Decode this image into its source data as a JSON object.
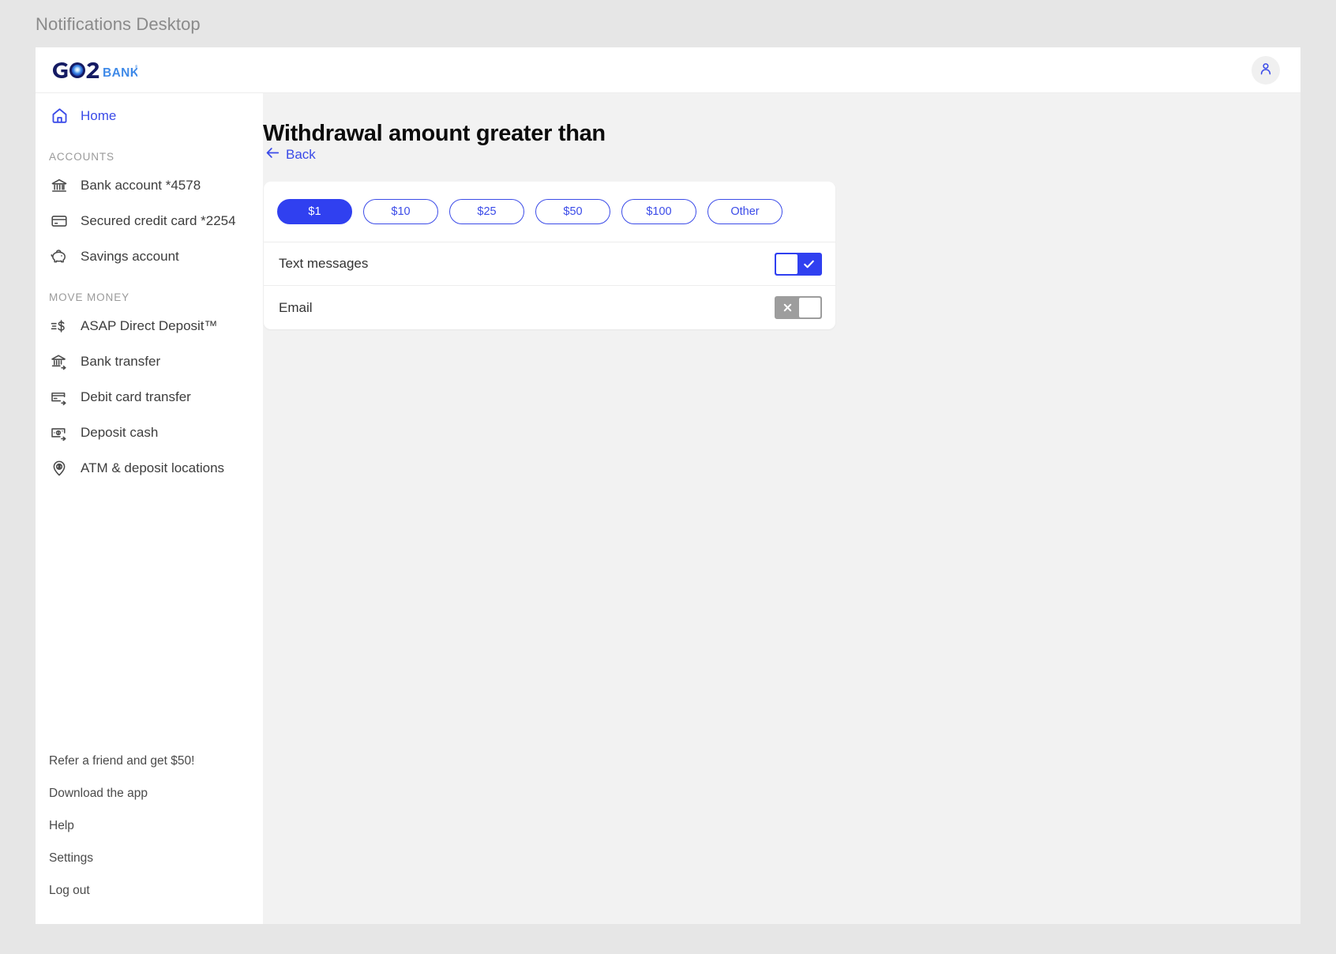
{
  "desktop": {
    "title": "Notifications Desktop"
  },
  "brand": {
    "logo_text_primary": "GO2",
    "logo_text_secondary": "BANK",
    "accent_blue": "#3040f0",
    "logo_navy": "#151b63",
    "logo_light_blue": "#3f8ae8"
  },
  "topbar": {
    "avatar_icon": "person-icon"
  },
  "sidebar": {
    "home": {
      "label": "Home",
      "icon": "home-icon",
      "active": true
    },
    "sections": [
      {
        "heading": "ACCOUNTS",
        "items": [
          {
            "label": "Bank account *4578",
            "icon": "bank-icon"
          },
          {
            "label": "Secured credit card *2254",
            "icon": "credit-card-icon"
          },
          {
            "label": "Savings account",
            "icon": "piggy-bank-icon"
          }
        ]
      },
      {
        "heading": "MOVE MONEY",
        "items": [
          {
            "label": "ASAP Direct Deposit™",
            "icon": "fast-dollar-icon"
          },
          {
            "label": "Bank transfer",
            "icon": "bank-arrow-icon"
          },
          {
            "label": "Debit card transfer",
            "icon": "card-arrow-icon"
          },
          {
            "label": "Deposit cash",
            "icon": "cash-arrow-icon"
          },
          {
            "label": "ATM & deposit locations",
            "icon": "map-pin-dollar-icon"
          }
        ]
      }
    ],
    "footer_links": [
      {
        "label": "Refer a friend and get $50!"
      },
      {
        "label": "Download the app"
      },
      {
        "label": "Help"
      },
      {
        "label": "Settings"
      },
      {
        "label": "Log out"
      }
    ]
  },
  "main": {
    "title": "Withdrawal amount greater than",
    "back_label": "Back",
    "back_icon": "arrow-left-icon",
    "amount_options": [
      {
        "label": "$1",
        "selected": true
      },
      {
        "label": "$10",
        "selected": false
      },
      {
        "label": "$25",
        "selected": false
      },
      {
        "label": "$50",
        "selected": false
      },
      {
        "label": "$100",
        "selected": false
      },
      {
        "label": "Other",
        "selected": false
      }
    ],
    "channels": [
      {
        "label": "Text messages",
        "enabled": true,
        "state_icon": "check-icon"
      },
      {
        "label": "Email",
        "enabled": false,
        "state_icon": "x-icon"
      }
    ]
  }
}
